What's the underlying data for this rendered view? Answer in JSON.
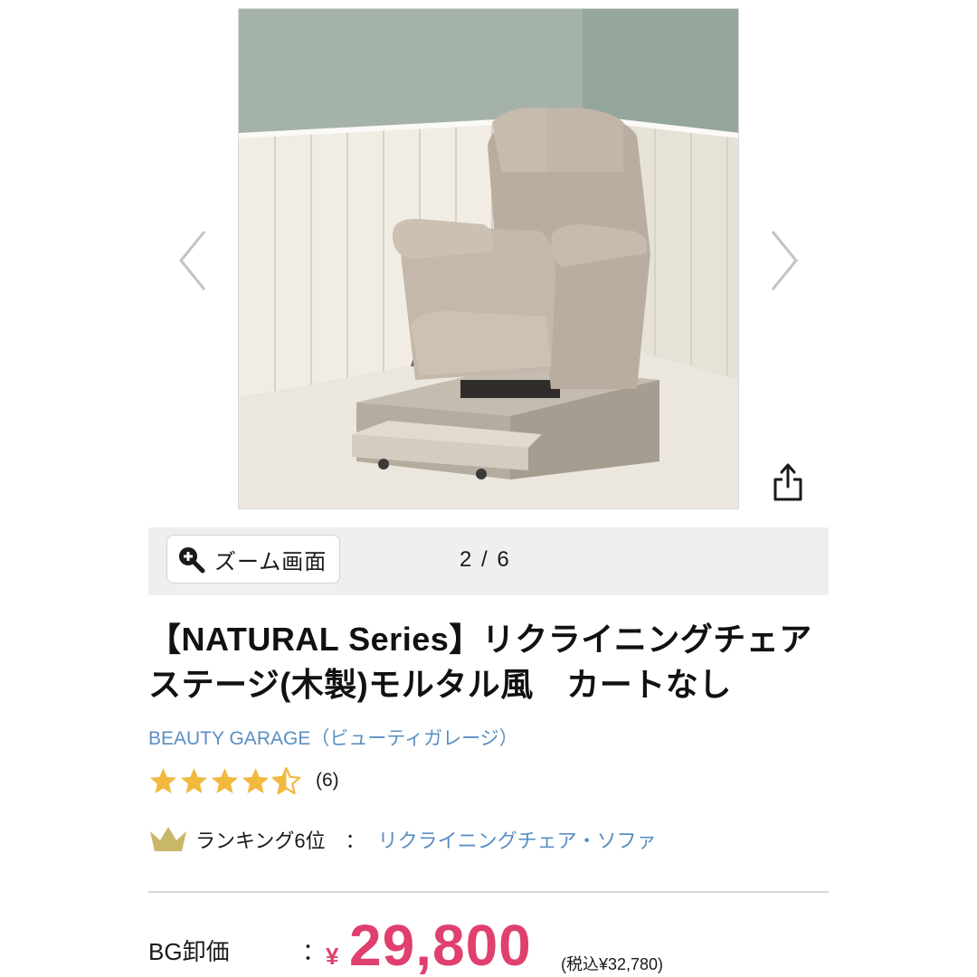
{
  "gallery": {
    "image_alt": "リクライニングチェアステージ モルタル風",
    "zoom_label": "ズーム画面",
    "page_counter": "2 / 6",
    "icons": {
      "prev": "chevron-left-icon",
      "next": "chevron-right-icon",
      "share": "share-icon",
      "zoom": "zoom-in-icon"
    }
  },
  "product": {
    "title": "【NATURAL Series】リクライニングチェアステージ(木製)モルタル風　カートなし",
    "brand": "BEAUTY GARAGE（ビューティガレージ）",
    "rating": {
      "stars": 4.5,
      "max_stars": 5,
      "review_count": "(6)"
    },
    "ranking": {
      "label": "ランキング6位",
      "separator": "：",
      "category": "リクライニングチェア・ソファ"
    },
    "price": {
      "label": "BG卸価",
      "separator": "：",
      "currency": "¥",
      "value": "29,800",
      "tax_included": "(税込¥32,780)"
    }
  },
  "colors": {
    "accent_price": "#e0406e",
    "link": "#5a8fc2",
    "star": "#f2b93f",
    "crown": "#c7b766"
  }
}
